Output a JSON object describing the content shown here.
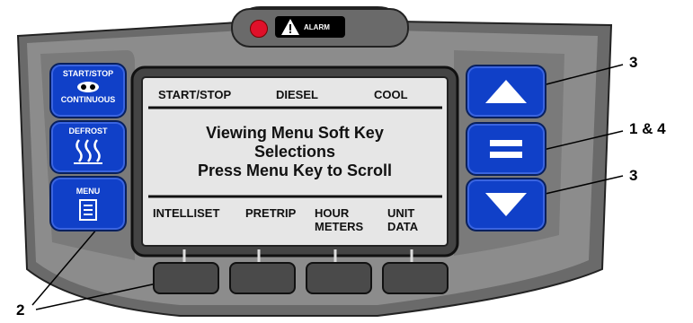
{
  "alarm": {
    "label": "ALARM",
    "icon": "warning-triangle-icon"
  },
  "left_keys": {
    "start_stop": {
      "top": "START/STOP",
      "bottom": "CONTINUOUS",
      "icon": "continuous-mode-icon"
    },
    "defrost": {
      "label": "DEFROST",
      "icon": "defrost-icon"
    },
    "menu": {
      "label": "MENU",
      "icon": "menu-list-icon"
    }
  },
  "display": {
    "top_row": [
      "START/STOP",
      "DIESEL",
      "COOL"
    ],
    "message_line1": "Viewing Menu Soft Key",
    "message_line2": "Selections",
    "message_line3": "Press Menu Key to Scroll",
    "soft_labels": [
      {
        "line1": "INTELLISET",
        "line2": ""
      },
      {
        "line1": "PRETRIP",
        "line2": ""
      },
      {
        "line1": "HOUR",
        "line2": "METERS"
      },
      {
        "line1": "UNIT",
        "line2": "DATA"
      }
    ]
  },
  "right_keys": {
    "up_icon": "up-arrow-icon",
    "enter_icon": "equals-icon",
    "down_icon": "down-arrow-icon"
  },
  "callouts": {
    "up": "3",
    "enter": "1 & 4",
    "down": "3",
    "soft": "2"
  },
  "colors": {
    "key_blue": "#1040c8",
    "bezel": "#8a8a8a",
    "lcd": "#e6e6e6",
    "led": "#e0102a"
  }
}
